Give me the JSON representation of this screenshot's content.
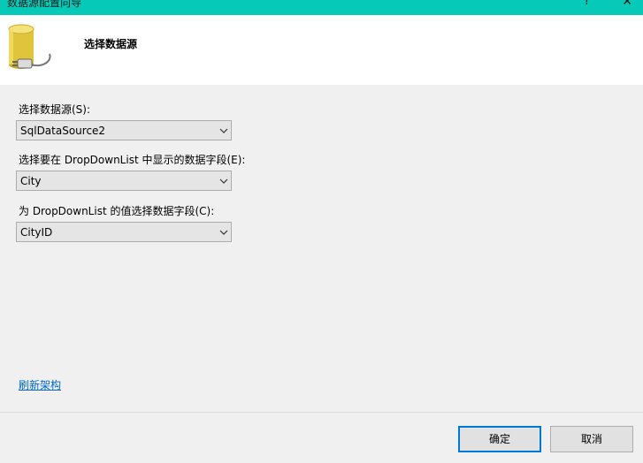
{
  "window": {
    "title": "数据源配置向导",
    "help_glyph": "?",
    "close_glyph": "✕"
  },
  "header": {
    "heading": "选择数据源",
    "icon": "database-icon"
  },
  "form": {
    "datasource_label": "选择数据源(S):",
    "datasource_value": "SqlDataSource2",
    "display_field_label": "选择要在 DropDownList 中显示的数据字段(E):",
    "display_field_value": "City",
    "value_field_label": "为 DropDownList 的值选择数据字段(C):",
    "value_field_value": "CityID"
  },
  "refresh_link": "刷新架构",
  "buttons": {
    "ok": "确定",
    "cancel": "取消"
  },
  "colors": {
    "titlebar": "#06c9b7",
    "primary_border": "#0078d7",
    "link": "#0066cc"
  }
}
